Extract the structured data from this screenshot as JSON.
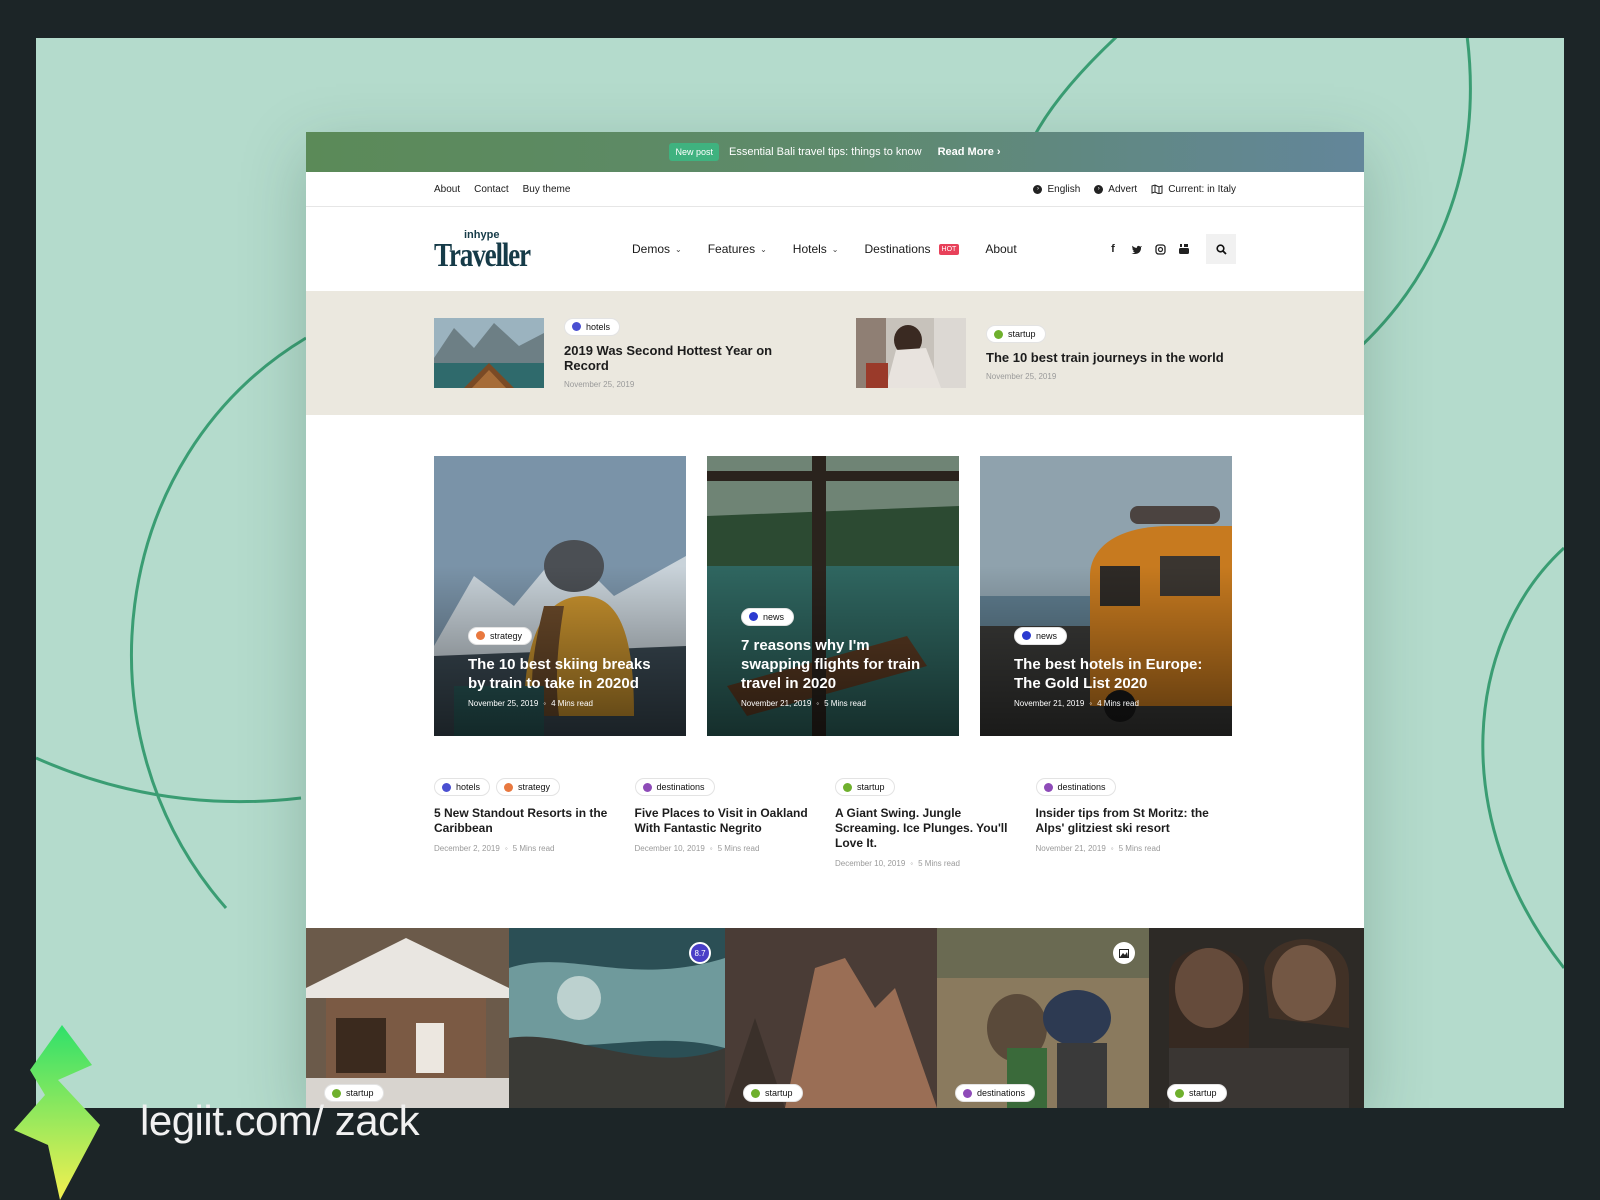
{
  "announcement": {
    "badge": "New post",
    "text": "Essential Bali travel tips: things to know",
    "cta": "Read More ›"
  },
  "utility": {
    "links": [
      "About",
      "Contact",
      "Buy theme"
    ],
    "language": "English",
    "advert": "Advert",
    "location": "Current: in Italy"
  },
  "logo": {
    "small": "inhype",
    "big": "Traveller"
  },
  "nav": [
    {
      "label": "Demos",
      "dropdown": true
    },
    {
      "label": "Features",
      "dropdown": true
    },
    {
      "label": "Hotels",
      "dropdown": true
    },
    {
      "label": "Destinations",
      "dropdown": false,
      "badge": "HOT"
    },
    {
      "label": "About",
      "dropdown": false
    }
  ],
  "social_icons": [
    "facebook-icon",
    "twitter-icon",
    "instagram-icon",
    "youtube-icon"
  ],
  "featured_strip": [
    {
      "category": "hotels",
      "color": "#4a4fd1",
      "title": "2019 Was Second Hottest Year on Record",
      "date": "November 25, 2019"
    },
    {
      "category": "startup",
      "color": "#6fb02d",
      "title": "The 10 best train journeys in the world",
      "date": "November 25, 2019"
    }
  ],
  "cards": [
    {
      "category": "strategy",
      "color": "#e8783f",
      "title": "The 10 best skiing breaks by train to take in 2020d",
      "date": "November 25, 2019",
      "read": "4 Mins read"
    },
    {
      "category": "news",
      "color": "#2b3ad0",
      "title": "7 reasons why I'm swapping flights for train travel in 2020",
      "date": "November 21, 2019",
      "read": "5 Mins read"
    },
    {
      "category": "news",
      "color": "#2b3ad0",
      "title": "The best hotels in Europe: The Gold List 2020",
      "date": "November 21, 2019",
      "read": "4 Mins read"
    }
  ],
  "list_posts": [
    {
      "categories": [
        {
          "name": "hotels",
          "color": "#4a4fd1"
        },
        {
          "name": "strategy",
          "color": "#e8783f"
        }
      ],
      "title": "5 New Standout Resorts in the Caribbean",
      "date": "December 2, 2019",
      "read": "5 Mins read"
    },
    {
      "categories": [
        {
          "name": "destinations",
          "color": "#8e4bb8"
        }
      ],
      "title": "Five Places to Visit in Oakland With Fantastic Negrito",
      "date": "December 10, 2019",
      "read": "5 Mins read"
    },
    {
      "categories": [
        {
          "name": "startup",
          "color": "#6fb02d"
        }
      ],
      "title": "A Giant Swing. Jungle Screaming. Ice Plunges. You'll Love It.",
      "date": "December 10, 2019",
      "read": "5 Mins read"
    },
    {
      "categories": [
        {
          "name": "destinations",
          "color": "#8e4bb8"
        }
      ],
      "title": "Insider tips from St Moritz: the Alps' glitziest ski resort",
      "date": "November 21, 2019",
      "read": "5 Mins read"
    }
  ],
  "gallery": [
    {
      "category": "startup",
      "color": "#6fb02d",
      "badge": ""
    },
    {
      "category": "",
      "color": "",
      "badge": "8.7"
    },
    {
      "category": "startup",
      "color": "#6fb02d",
      "badge": ""
    },
    {
      "category": "destinations",
      "color": "#8e4bb8",
      "badge": "image-icon"
    },
    {
      "category": "startup",
      "color": "#6fb02d",
      "badge": ""
    }
  ],
  "watermark": {
    "text": "legiit.com/ zack"
  },
  "colors": {
    "page_bg": "#b4dbcc",
    "frame": "#1c2527",
    "accent_line": "#3a9d73",
    "logo": "#163b48",
    "strip_bg": "#ebe8df"
  }
}
